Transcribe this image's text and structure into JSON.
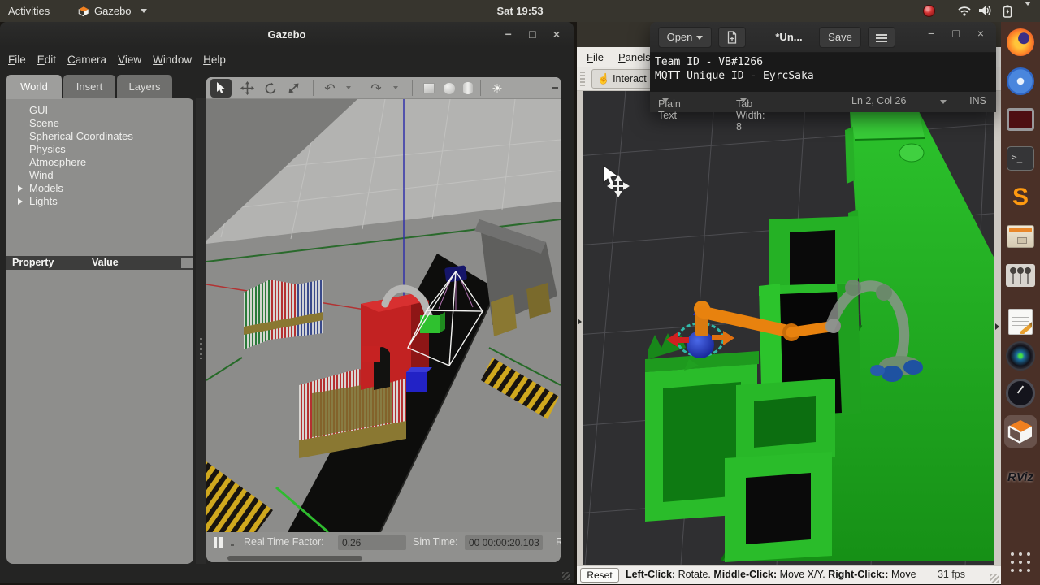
{
  "topbar": {
    "activities": "Activities",
    "app_name": "Gazebo",
    "clock": "Sat 19:53"
  },
  "gazebo": {
    "title": "Gazebo",
    "controls": {
      "min": "−",
      "max": "□",
      "close": "×"
    },
    "menus": [
      "File",
      "Edit",
      "Camera",
      "View",
      "Window",
      "Help"
    ],
    "tabs": [
      "World",
      "Insert",
      "Layers"
    ],
    "tree": [
      "GUI",
      "Scene",
      "Spherical Coordinates",
      "Physics",
      "Atmosphere",
      "Wind",
      "Models",
      "Lights"
    ],
    "columns": {
      "property": "Property",
      "value": "Value"
    },
    "toolbar": {
      "undo_glyph": "↶",
      "redo_glyph": "↷",
      "light_glyph": "☀"
    },
    "status": {
      "rtf_label": "Real Time Factor:",
      "rtf_value": "0.26",
      "sim_label": "Sim Time:",
      "sim_value": "00 00:00:20.103",
      "clipped": "R"
    }
  },
  "gedit": {
    "open": "Open",
    "doc_title": "*Un...",
    "save": "Save",
    "controls": {
      "min": "−",
      "max": "□",
      "close": "×"
    },
    "lines": [
      "Team ID - VB#1266",
      "MQTT Unique ID - EyrcSaka"
    ],
    "status": {
      "lang": "Plain Text",
      "tab_width": "Tab Width: 8",
      "position": "Ln 2, Col 26",
      "mode": "INS"
    }
  },
  "rviz": {
    "menus": [
      "File",
      "Panels"
    ],
    "interact": "Interact",
    "interact_glyph": "☝",
    "status": {
      "reset": "Reset",
      "help": [
        {
          "b": "Left-Click:",
          "t": " Rotate. "
        },
        {
          "b": "Middle-Click:",
          "t": " Move X/Y. "
        },
        {
          "b": "Right-Click::",
          "t": " Move"
        }
      ],
      "fps": "31 fps"
    }
  },
  "dock": {
    "rviz_label": "RViz"
  }
}
